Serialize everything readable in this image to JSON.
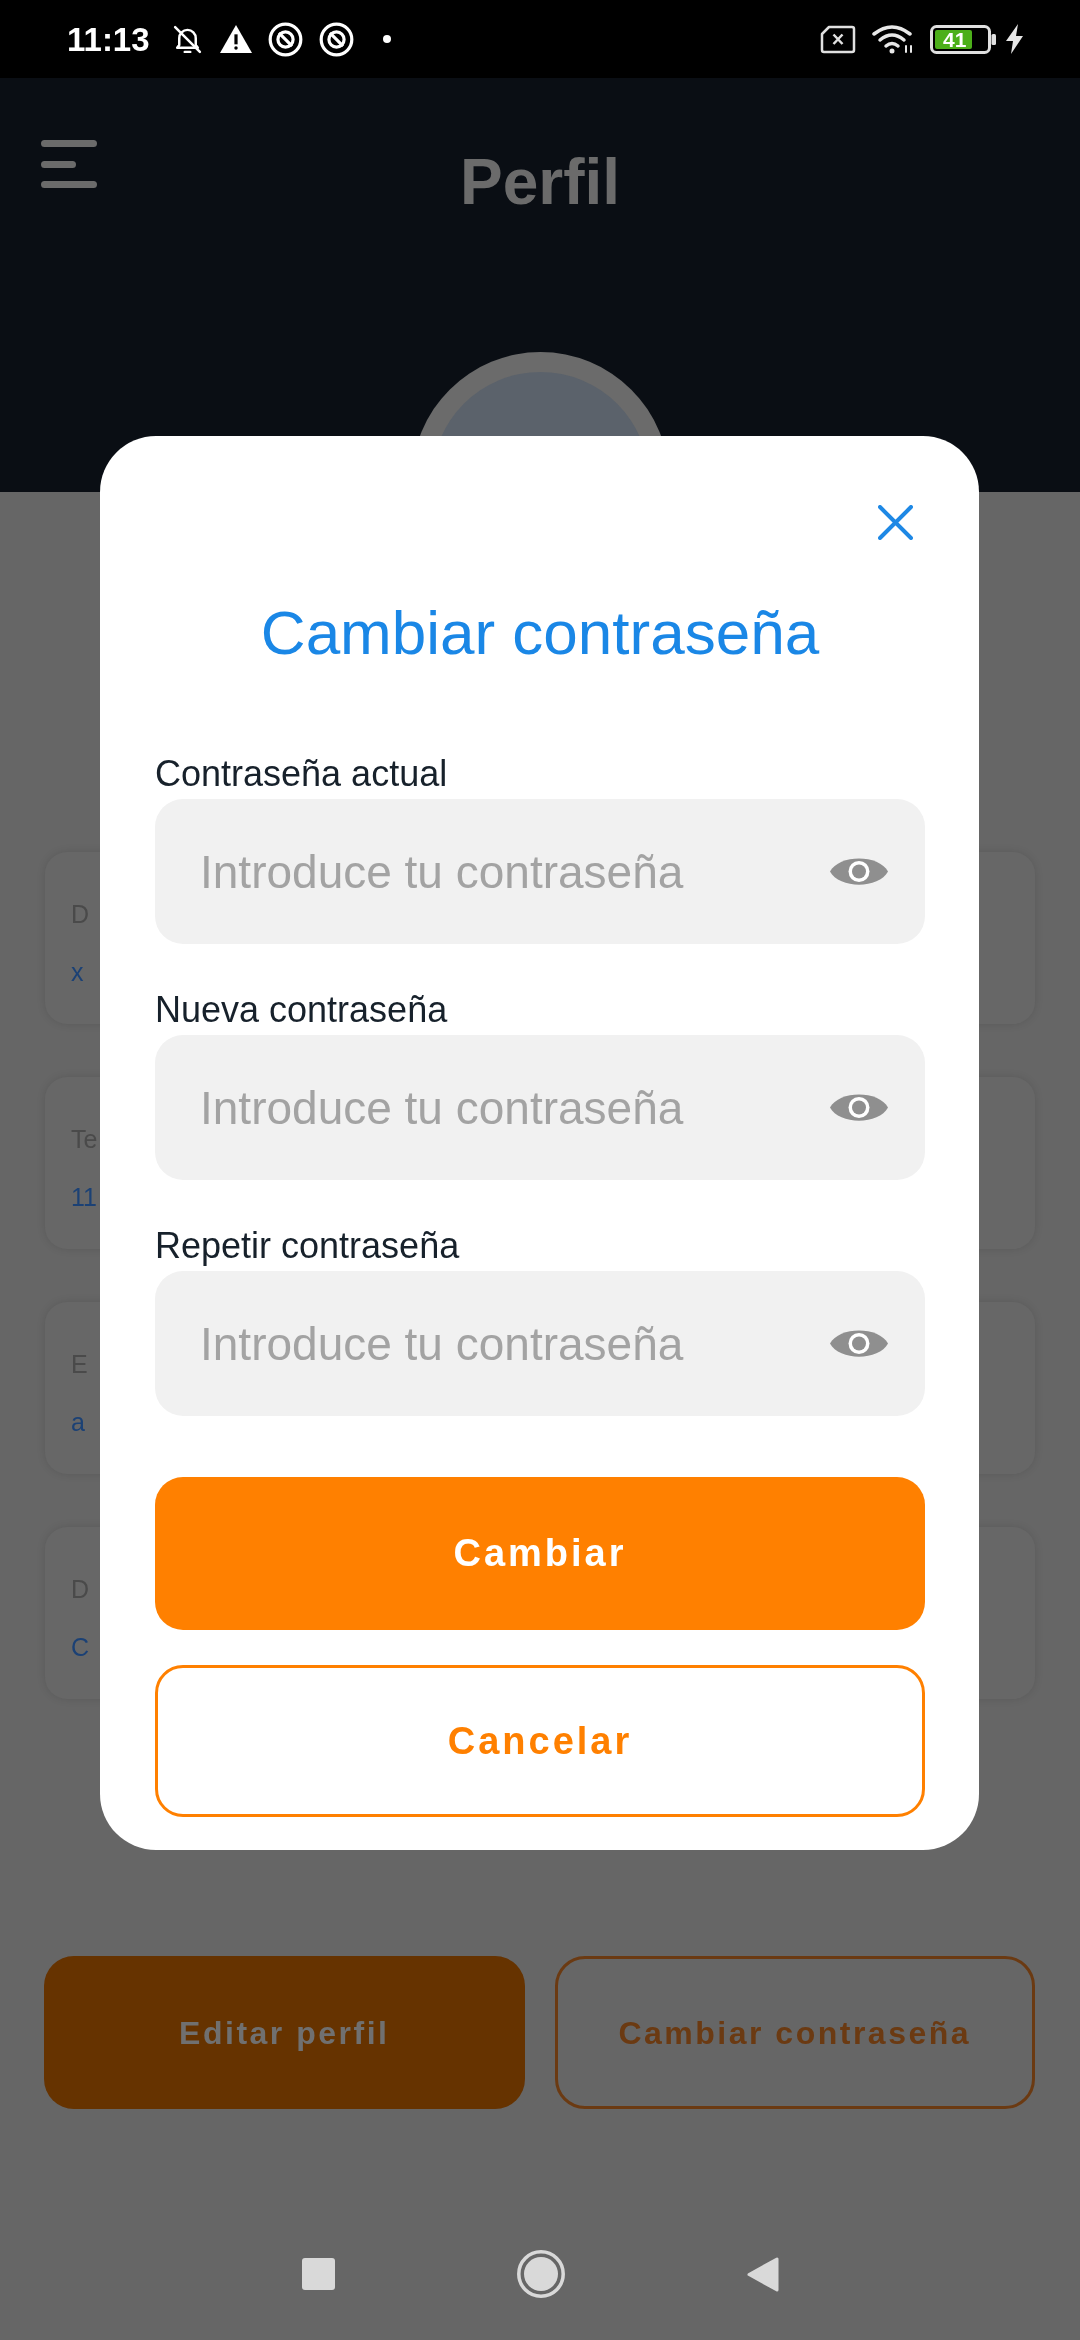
{
  "status_bar": {
    "time": "11:13",
    "battery": "41"
  },
  "header": {
    "title": "Perfil"
  },
  "profile_cards": [
    {
      "label": "D",
      "value": "x"
    },
    {
      "label": "Te",
      "value": "11"
    },
    {
      "label": "E",
      "value": "a"
    },
    {
      "label": "D",
      "value": "C"
    }
  ],
  "actions": [
    {
      "label": "Editar perfil",
      "kind": "filled"
    },
    {
      "label": "Cambiar contraseña",
      "kind": "outline"
    }
  ],
  "dialog": {
    "title": "Cambiar contraseña",
    "fields": [
      {
        "label": "Contraseña actual",
        "placeholder": "Introduce tu contraseña"
      },
      {
        "label": "Nueva contraseña",
        "placeholder": "Introduce tu contraseña"
      },
      {
        "label": "Repetir contraseña",
        "placeholder": "Introduce tu contraseña"
      }
    ],
    "buttons": [
      {
        "label": "Cambiar",
        "kind": "filled"
      },
      {
        "label": "Cancelar",
        "kind": "outline"
      }
    ]
  }
}
